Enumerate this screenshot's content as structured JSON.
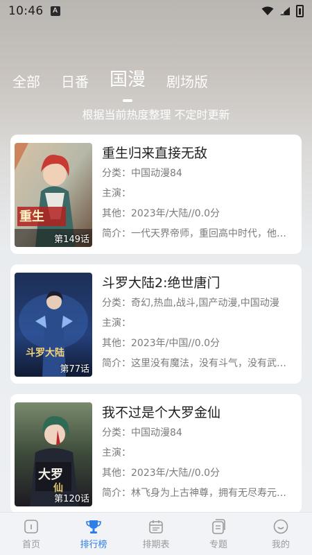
{
  "status_bar": {
    "time": "10:46",
    "notification": "A"
  },
  "tabs": [
    {
      "label": "全部",
      "active": false
    },
    {
      "label": "日番",
      "active": false
    },
    {
      "label": "国漫",
      "active": true
    },
    {
      "label": "剧场版",
      "active": false
    }
  ],
  "subtitle": "根据当前热度整理 不定时更新",
  "cards": [
    {
      "title": "重生归来直接无敌",
      "category": "分类：中国动漫84",
      "cast": "主演：",
      "other": "其他：2023年/大陆//0.0分",
      "intro": "简介：一代天界帝师，重回高中时代，他…",
      "episodes": "第149话",
      "poster_icon": "anime-poster-red-hair"
    },
    {
      "title": "斗罗大陆2:绝世唐门",
      "category": "分类：奇幻,热血,战斗,国产动漫,中国动漫",
      "cast": "主演：",
      "other": "其他：2023年/中国//0.0分",
      "intro": "简介：这里没有魔法，没有斗气，没有武…",
      "episodes": "第77话",
      "poster_icon": "anime-poster-blue-warrior"
    },
    {
      "title": "我不过是个大罗金仙",
      "category": "分类：中国动漫84",
      "cast": "主演：",
      "other": "其他：2023年/大陆//0.0分",
      "intro": "简介：林飞身为上古神尊，拥有无尽寿元…",
      "episodes": "第120话",
      "poster_icon": "anime-poster-green-hair"
    }
  ],
  "bottom_nav": [
    {
      "label": "首页",
      "icon": "home-icon",
      "active": false
    },
    {
      "label": "排行榜",
      "icon": "trophy-icon",
      "active": true
    },
    {
      "label": "排期表",
      "icon": "calendar-icon",
      "active": false
    },
    {
      "label": "专题",
      "icon": "topics-icon",
      "active": false
    },
    {
      "label": "我的",
      "icon": "profile-icon",
      "active": false
    }
  ],
  "colors": {
    "accent": "#2f7ee8",
    "inactive": "#9a9a9a"
  }
}
